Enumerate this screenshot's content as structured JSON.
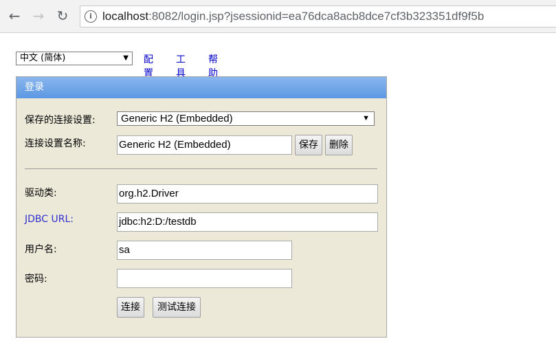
{
  "browser": {
    "url_host": "localhost",
    "url_rest": ":8082/login.jsp?jsessionid=ea76dca8acb8dce7cf3b323351df9f5b"
  },
  "toolbar": {
    "language": "中文 (简体)",
    "links": [
      "配置",
      "工具",
      "帮助"
    ]
  },
  "panel": {
    "title": "登录",
    "saved_settings_label": "保存的连接设置:",
    "saved_settings_value": "Generic H2 (Embedded)",
    "setting_name_label": "连接设置名称:",
    "setting_name_value": "Generic H2 (Embedded)",
    "save_button": "保存",
    "delete_button": "删除",
    "driver_label": "驱动类:",
    "driver_value": "org.h2.Driver",
    "jdbc_url_label": "JDBC URL:",
    "jdbc_url_value": "jdbc:h2:D:/testdb",
    "username_label": "用户名:",
    "username_value": "sa",
    "password_label": "密码:",
    "password_value": "",
    "connect_button": "连接",
    "test_button": "测试连接"
  }
}
